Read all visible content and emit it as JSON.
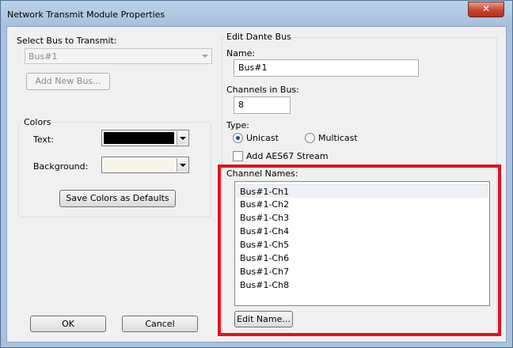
{
  "window": {
    "title": "Network Transmit Module Properties",
    "close_glyph": "✕"
  },
  "left": {
    "select_bus_label": "Select Bus to Transmit:",
    "bus_select_value": "Bus#1",
    "add_bus_label": "Add New Bus...",
    "colors_group_label": "Colors",
    "text_color_label": "Text:",
    "text_color_value": "#000000",
    "background_color_label": "Background:",
    "background_color_value": "#f8f6e8",
    "save_colors_label": "Save Colors as Defaults"
  },
  "right": {
    "group_label": "Edit Dante Bus",
    "name_label": "Name:",
    "name_value": "Bus#1",
    "channels_label": "Channels in Bus:",
    "channels_value": "8",
    "type_label": "Type:",
    "type_options": [
      "Unicast",
      "Multicast"
    ],
    "type_selected": "Unicast",
    "aes67_label": "Add AES67 Stream",
    "aes67_checked": false,
    "channel_names_label": "Channel Names:",
    "channel_names": [
      "Bus#1-Ch1",
      "Bus#1-Ch2",
      "Bus#1-Ch3",
      "Bus#1-Ch4",
      "Bus#1-Ch5",
      "Bus#1-Ch6",
      "Bus#1-Ch7",
      "Bus#1-Ch8"
    ],
    "selected_channel": "Bus#1-Ch1",
    "edit_name_label": "Edit Name..."
  },
  "footer": {
    "ok_label": "OK",
    "cancel_label": "Cancel"
  },
  "colors": {
    "highlight": "#e0141e",
    "titlebar": "#a9c1dc",
    "dialog_face": "#f0f0f0"
  }
}
